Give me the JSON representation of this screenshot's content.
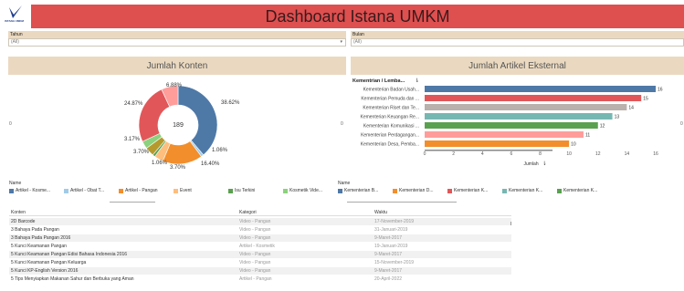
{
  "header": {
    "title": "Dashboard Istana UMKM",
    "logo_text": "ISTANA UMKM"
  },
  "filters": {
    "tahun": {
      "label": "Tahun",
      "value": "(All)"
    },
    "bulan": {
      "label": "Bulan",
      "value": "(All)"
    }
  },
  "donut_panel": {
    "title": "Jumlah Konten",
    "center_value": "189",
    "axis_zero_left": "0",
    "axis_zero_right": "0",
    "labels": [
      "38.62%",
      "1.06%",
      "16.40%",
      "3.70%",
      "1.06%",
      "3.70%",
      "3.17%",
      "24.87%",
      "6.88%"
    ]
  },
  "bar_panel": {
    "title": "Jumlah Artikel Eksternal",
    "axis_zero": "0"
  },
  "legend_left": {
    "title": "Name",
    "items": [
      {
        "label": "Artikel - Kosme...",
        "color": "#4e79a7"
      },
      {
        "label": "Artikel - Obat T...",
        "color": "#a0cbe8"
      },
      {
        "label": "Artikel - Pangan",
        "color": "#f28e2b"
      },
      {
        "label": "Event",
        "color": "#ffbe7d"
      },
      {
        "label": "Isu Terkini",
        "color": "#59a14f"
      },
      {
        "label": "Kosmetik Vide...",
        "color": "#8cd17d"
      }
    ]
  },
  "legend_right": {
    "title": "Name",
    "items": [
      {
        "label": "Kementerian B...",
        "color": "#4e79a7"
      },
      {
        "label": "Kementerian D...",
        "color": "#f28e2b"
      },
      {
        "label": "Kementerian K...",
        "color": "#e15759"
      },
      {
        "label": "Kementerian K...",
        "color": "#76b7b2"
      },
      {
        "label": "Kementerian K...",
        "color": "#59a14f"
      }
    ]
  },
  "table": {
    "headers": [
      "Konten",
      "Kategori",
      "Waktu"
    ],
    "rows": [
      [
        "2D Barcode",
        "Video - Pangan",
        "17-November-2019"
      ],
      [
        "3 Bahaya Pada Pangan",
        "Video - Pangan",
        "31-Januari-2019"
      ],
      [
        "3 Bahaya Pada Pangan 2016",
        "Video - Pangan",
        "9-Maret-2017"
      ],
      [
        "5 Kunci Keamanan Pangan",
        "Artikel - Kosmetik",
        "19-Januari-2019"
      ],
      [
        "5 Kunci Keamanan Pangan Edisi Bahasa Indonesia 2016",
        "Video - Pangan",
        "9-Maret-2017"
      ],
      [
        "5 Kunci Keamanan Pangan Keluarga",
        "Video - Pangan",
        "15-November-2019"
      ],
      [
        "5 Kunci KP-English Version 2016",
        "Video - Pangan",
        "9-Maret-2017"
      ],
      [
        "5 Tips Menyiapkan Makanan Sahur dan Berbuka yang Aman",
        "Artikel - Pangan",
        "20-April-2022"
      ]
    ]
  },
  "chart_data": [
    {
      "type": "pie",
      "title": "Jumlah Konten",
      "total": 189,
      "slices": [
        {
          "label": "38.62%",
          "value": 38.62,
          "color": "#4e79a7"
        },
        {
          "label": "1.06%",
          "value": 1.06,
          "color": "#a0cbe8"
        },
        {
          "label": "16.40%",
          "value": 16.4,
          "color": "#f28e2b"
        },
        {
          "label": "3.70%",
          "value": 3.7,
          "color": "#ffbe7d"
        },
        {
          "label": "1.06%",
          "value": 1.06,
          "color": "#59a14f"
        },
        {
          "label": "3.70%",
          "value": 3.7,
          "color": "#b6992d"
        },
        {
          "label": "3.17%",
          "value": 3.17,
          "color": "#8cd17d"
        },
        {
          "label": "24.87%",
          "value": 24.87,
          "color": "#e15759"
        },
        {
          "label": "6.88%",
          "value": 6.88,
          "color": "#ff9d9a"
        }
      ]
    },
    {
      "type": "bar",
      "title": "Jumlah Artikel Eksternal",
      "orientation": "horizontal",
      "row_header": "Kementrian / Lemba...",
      "xlabel": "Jumlah",
      "xlim": [
        0,
        16
      ],
      "ticks": [
        "0",
        "2",
        "4",
        "6",
        "8",
        "10",
        "12",
        "14",
        "16"
      ],
      "categories": [
        "Kementerian Badan Usah...",
        "Kementerian Pemuda dan ...",
        "Kementerian Riset dan Te...",
        "Kementerian Keuangan Re...",
        "Kementerian Komunikasi ...",
        "Kementerian Perdagangan...",
        "Kementerian Desa, Pemba..."
      ],
      "values": [
        16,
        15,
        14,
        13,
        12,
        11,
        10
      ],
      "value_labels": [
        "16",
        "15",
        "14",
        "13",
        "12",
        "11",
        "10"
      ],
      "colors": [
        "#4e79a7",
        "#e15759",
        "#bab0ac",
        "#76b7b2",
        "#59a14f",
        "#ff9d9a",
        "#f28e2b"
      ]
    }
  ]
}
